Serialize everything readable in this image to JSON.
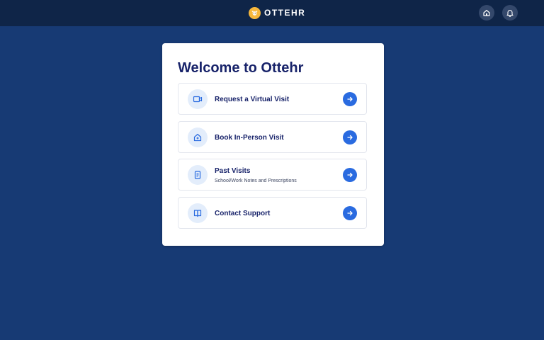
{
  "header": {
    "brand_name": "OTTEHR",
    "logo_icon": "otter-logo",
    "right_icons": [
      "home-icon",
      "bell-icon"
    ]
  },
  "card": {
    "title": "Welcome to Ottehr",
    "options": [
      {
        "label": "Request a Virtual Visit",
        "subtitle": "",
        "icon": "video-icon"
      },
      {
        "label": "Book In-Person Visit",
        "subtitle": "",
        "icon": "clinic-icon"
      },
      {
        "label": "Past Visits",
        "subtitle": "School/Work Notes and Prescriptions",
        "icon": "document-icon"
      },
      {
        "label": "Contact Support",
        "subtitle": "",
        "icon": "book-icon"
      }
    ]
  },
  "colors": {
    "page_bg": "#173a74",
    "topbar_bg": "#0f2548",
    "accent": "#2a6be0",
    "title_text": "#18236a"
  }
}
